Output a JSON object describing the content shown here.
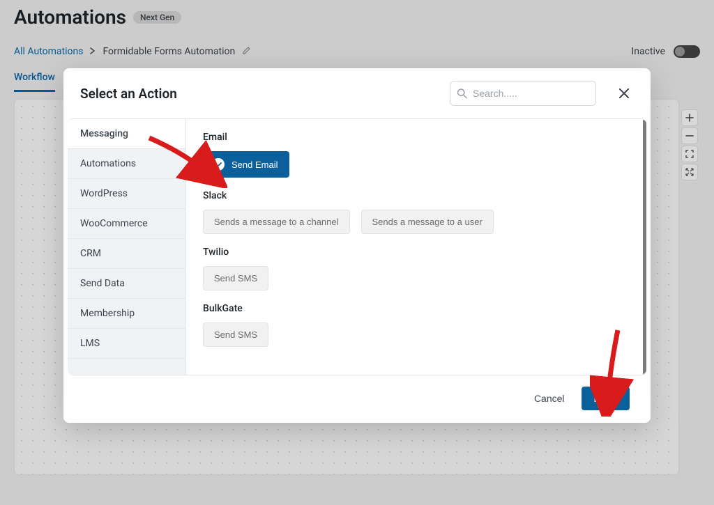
{
  "page": {
    "title": "Automations",
    "badge": "Next Gen",
    "breadcrumb": {
      "root": "All Automations",
      "current": "Formidable Forms Automation"
    },
    "status_label": "Inactive",
    "tab_workflow": "Workflow"
  },
  "modal": {
    "title": "Select an Action",
    "search_placeholder": "Search.....",
    "categories": [
      "Messaging",
      "Automations",
      "WordPress",
      "WooCommerce",
      "CRM",
      "Send Data",
      "Membership",
      "LMS"
    ],
    "groups": {
      "email_label": "Email",
      "send_email": "Send Email",
      "slack_label": "Slack",
      "slack_channel": "Sends a message to a channel",
      "slack_user": "Sends a message to a user",
      "twilio_label": "Twilio",
      "twilio_sms": "Send SMS",
      "bulkgate_label": "BulkGate",
      "bulkgate_sms": "Send SMS"
    },
    "cancel": "Cancel",
    "done": "Done"
  }
}
